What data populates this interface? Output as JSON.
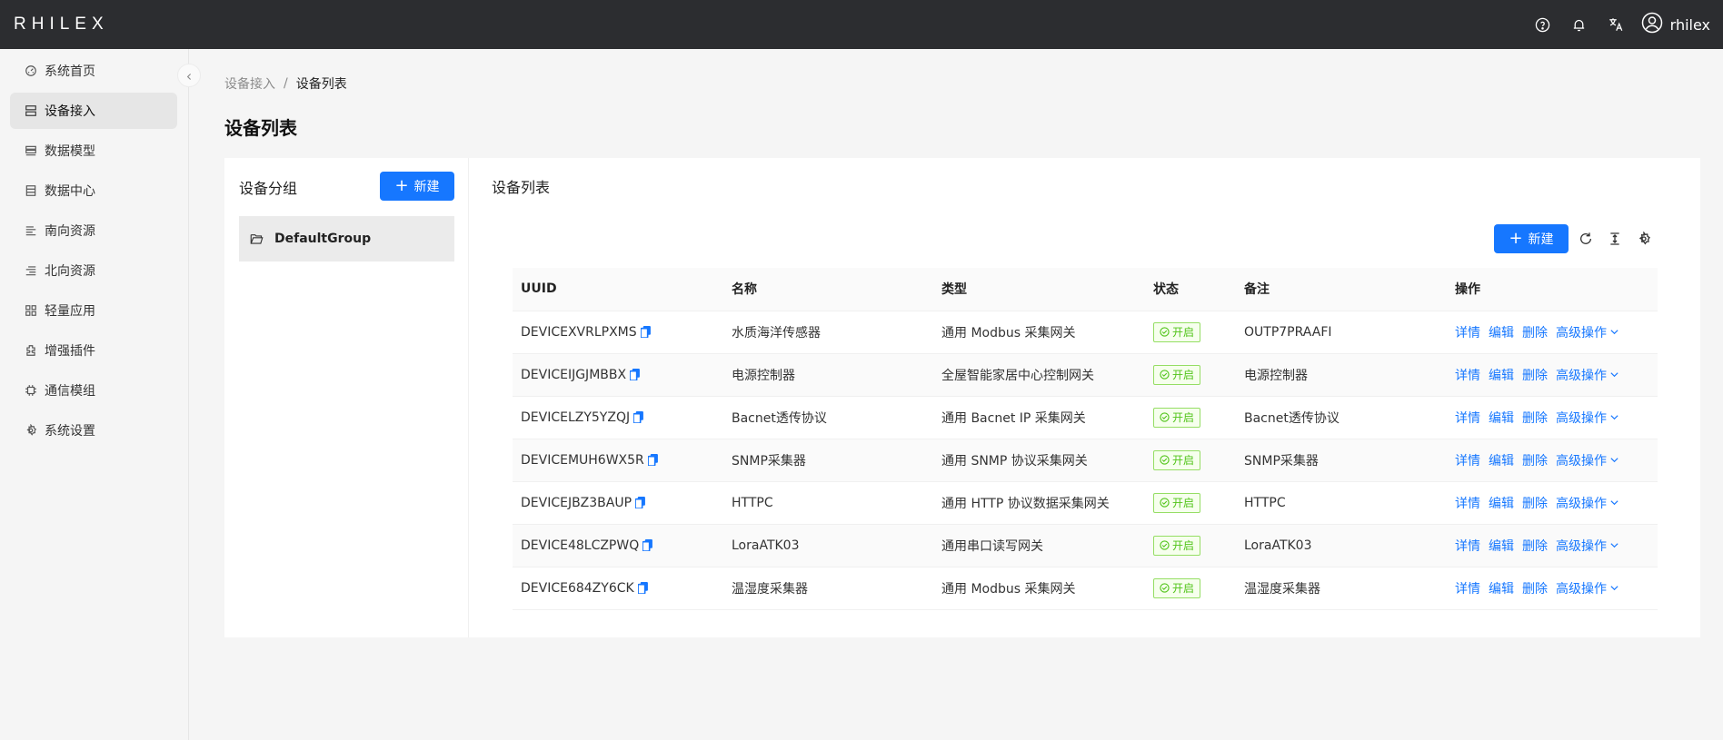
{
  "app": {
    "logo": "RHILEX",
    "user_name": "rhilex"
  },
  "topbar": {
    "icons": [
      "help-icon",
      "bell-icon",
      "translate-icon",
      "user-icon"
    ]
  },
  "sidebar": {
    "items": [
      {
        "label": "系统首页",
        "icon": "dashboard-icon",
        "active": false
      },
      {
        "label": "设备接入",
        "icon": "device-icon",
        "active": true
      },
      {
        "label": "数据模型",
        "icon": "model-icon",
        "active": false
      },
      {
        "label": "数据中心",
        "icon": "database-icon",
        "active": false
      },
      {
        "label": "南向资源",
        "icon": "south-icon",
        "active": false
      },
      {
        "label": "北向资源",
        "icon": "north-icon",
        "active": false
      },
      {
        "label": "轻量应用",
        "icon": "apps-icon",
        "active": false
      },
      {
        "label": "增强插件",
        "icon": "plugin-icon",
        "active": false
      },
      {
        "label": "通信模组",
        "icon": "module-icon",
        "active": false
      },
      {
        "label": "系统设置",
        "icon": "settings-icon",
        "active": false
      }
    ]
  },
  "breadcrumb": {
    "parent": "设备接入",
    "separator": "/",
    "current": "设备列表"
  },
  "page": {
    "title": "设备列表"
  },
  "groups": {
    "title": "设备分组",
    "new_label": "新建",
    "items": [
      {
        "label": "DefaultGroup"
      }
    ]
  },
  "devices": {
    "title": "设备列表",
    "new_label": "新建",
    "columns": [
      "UUID",
      "名称",
      "类型",
      "状态",
      "备注",
      "操作"
    ],
    "rows": [
      {
        "uuid": "DEVICEXVRLPXMS",
        "name": "水质海洋传感器",
        "type": "通用 Modbus 采集网关",
        "status": "开启",
        "remark": "OUTP7PRAAFI"
      },
      {
        "uuid": "DEVICEIJGJMBBX",
        "name": "电源控制器",
        "type": "全屋智能家居中心控制网关",
        "status": "开启",
        "remark": "电源控制器"
      },
      {
        "uuid": "DEVICELZY5YZQJ",
        "name": "Bacnet透传协议",
        "type": "通用 Bacnet IP 采集网关",
        "status": "开启",
        "remark": "Bacnet透传协议"
      },
      {
        "uuid": "DEVICEMUH6WX5R",
        "name": "SNMP采集器",
        "type": "通用 SNMP 协议采集网关",
        "status": "开启",
        "remark": "SNMP采集器"
      },
      {
        "uuid": "DEVICEJBZ3BAUP",
        "name": "HTTPC",
        "type": "通用 HTTP 协议数据采集网关",
        "status": "开启",
        "remark": "HTTPC"
      },
      {
        "uuid": "DEVICE48LCZPWQ",
        "name": "LoraATK03",
        "type": "通用串口读写网关",
        "status": "开启",
        "remark": "LoraATK03"
      },
      {
        "uuid": "DEVICE684ZY6CK",
        "name": "温湿度采集器",
        "type": "通用 Modbus 采集网关",
        "status": "开启",
        "remark": "温湿度采集器"
      }
    ],
    "actions": {
      "detail": "详情",
      "edit": "编辑",
      "delete": "删除",
      "advanced": "高级操作"
    }
  },
  "colors": {
    "primary": "#1677ff",
    "topbar": "#2c2d30",
    "success": "#52c41a"
  }
}
